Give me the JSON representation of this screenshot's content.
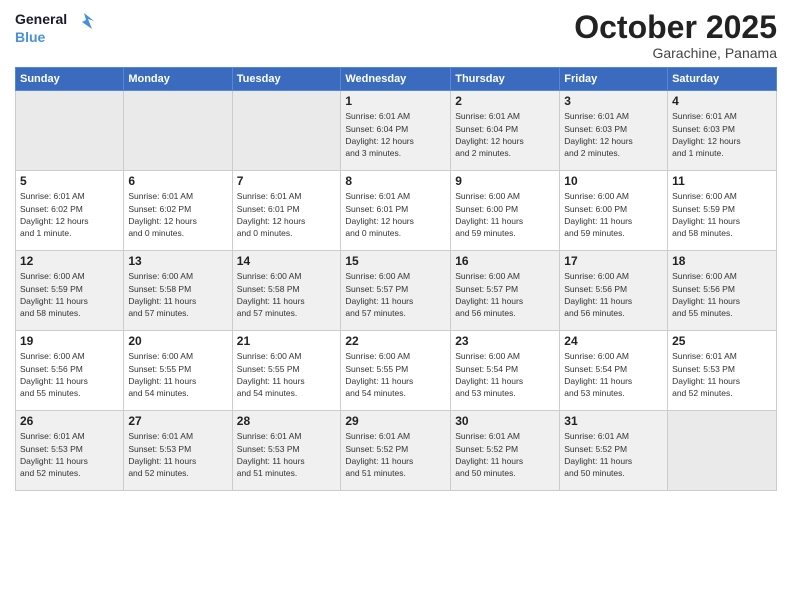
{
  "header": {
    "logo_line1": "General",
    "logo_line2": "Blue",
    "month": "October 2025",
    "location": "Garachine, Panama"
  },
  "weekdays": [
    "Sunday",
    "Monday",
    "Tuesday",
    "Wednesday",
    "Thursday",
    "Friday",
    "Saturday"
  ],
  "weeks": [
    [
      {
        "day": "",
        "info": ""
      },
      {
        "day": "",
        "info": ""
      },
      {
        "day": "",
        "info": ""
      },
      {
        "day": "1",
        "info": "Sunrise: 6:01 AM\nSunset: 6:04 PM\nDaylight: 12 hours\nand 3 minutes."
      },
      {
        "day": "2",
        "info": "Sunrise: 6:01 AM\nSunset: 6:04 PM\nDaylight: 12 hours\nand 2 minutes."
      },
      {
        "day": "3",
        "info": "Sunrise: 6:01 AM\nSunset: 6:03 PM\nDaylight: 12 hours\nand 2 minutes."
      },
      {
        "day": "4",
        "info": "Sunrise: 6:01 AM\nSunset: 6:03 PM\nDaylight: 12 hours\nand 1 minute."
      }
    ],
    [
      {
        "day": "5",
        "info": "Sunrise: 6:01 AM\nSunset: 6:02 PM\nDaylight: 12 hours\nand 1 minute."
      },
      {
        "day": "6",
        "info": "Sunrise: 6:01 AM\nSunset: 6:02 PM\nDaylight: 12 hours\nand 0 minutes."
      },
      {
        "day": "7",
        "info": "Sunrise: 6:01 AM\nSunset: 6:01 PM\nDaylight: 12 hours\nand 0 minutes."
      },
      {
        "day": "8",
        "info": "Sunrise: 6:01 AM\nSunset: 6:01 PM\nDaylight: 12 hours\nand 0 minutes."
      },
      {
        "day": "9",
        "info": "Sunrise: 6:00 AM\nSunset: 6:00 PM\nDaylight: 11 hours\nand 59 minutes."
      },
      {
        "day": "10",
        "info": "Sunrise: 6:00 AM\nSunset: 6:00 PM\nDaylight: 11 hours\nand 59 minutes."
      },
      {
        "day": "11",
        "info": "Sunrise: 6:00 AM\nSunset: 5:59 PM\nDaylight: 11 hours\nand 58 minutes."
      }
    ],
    [
      {
        "day": "12",
        "info": "Sunrise: 6:00 AM\nSunset: 5:59 PM\nDaylight: 11 hours\nand 58 minutes."
      },
      {
        "day": "13",
        "info": "Sunrise: 6:00 AM\nSunset: 5:58 PM\nDaylight: 11 hours\nand 57 minutes."
      },
      {
        "day": "14",
        "info": "Sunrise: 6:00 AM\nSunset: 5:58 PM\nDaylight: 11 hours\nand 57 minutes."
      },
      {
        "day": "15",
        "info": "Sunrise: 6:00 AM\nSunset: 5:57 PM\nDaylight: 11 hours\nand 57 minutes."
      },
      {
        "day": "16",
        "info": "Sunrise: 6:00 AM\nSunset: 5:57 PM\nDaylight: 11 hours\nand 56 minutes."
      },
      {
        "day": "17",
        "info": "Sunrise: 6:00 AM\nSunset: 5:56 PM\nDaylight: 11 hours\nand 56 minutes."
      },
      {
        "day": "18",
        "info": "Sunrise: 6:00 AM\nSunset: 5:56 PM\nDaylight: 11 hours\nand 55 minutes."
      }
    ],
    [
      {
        "day": "19",
        "info": "Sunrise: 6:00 AM\nSunset: 5:56 PM\nDaylight: 11 hours\nand 55 minutes."
      },
      {
        "day": "20",
        "info": "Sunrise: 6:00 AM\nSunset: 5:55 PM\nDaylight: 11 hours\nand 54 minutes."
      },
      {
        "day": "21",
        "info": "Sunrise: 6:00 AM\nSunset: 5:55 PM\nDaylight: 11 hours\nand 54 minutes."
      },
      {
        "day": "22",
        "info": "Sunrise: 6:00 AM\nSunset: 5:55 PM\nDaylight: 11 hours\nand 54 minutes."
      },
      {
        "day": "23",
        "info": "Sunrise: 6:00 AM\nSunset: 5:54 PM\nDaylight: 11 hours\nand 53 minutes."
      },
      {
        "day": "24",
        "info": "Sunrise: 6:00 AM\nSunset: 5:54 PM\nDaylight: 11 hours\nand 53 minutes."
      },
      {
        "day": "25",
        "info": "Sunrise: 6:01 AM\nSunset: 5:53 PM\nDaylight: 11 hours\nand 52 minutes."
      }
    ],
    [
      {
        "day": "26",
        "info": "Sunrise: 6:01 AM\nSunset: 5:53 PM\nDaylight: 11 hours\nand 52 minutes."
      },
      {
        "day": "27",
        "info": "Sunrise: 6:01 AM\nSunset: 5:53 PM\nDaylight: 11 hours\nand 52 minutes."
      },
      {
        "day": "28",
        "info": "Sunrise: 6:01 AM\nSunset: 5:53 PM\nDaylight: 11 hours\nand 51 minutes."
      },
      {
        "day": "29",
        "info": "Sunrise: 6:01 AM\nSunset: 5:52 PM\nDaylight: 11 hours\nand 51 minutes."
      },
      {
        "day": "30",
        "info": "Sunrise: 6:01 AM\nSunset: 5:52 PM\nDaylight: 11 hours\nand 50 minutes."
      },
      {
        "day": "31",
        "info": "Sunrise: 6:01 AM\nSunset: 5:52 PM\nDaylight: 11 hours\nand 50 minutes."
      },
      {
        "day": "",
        "info": ""
      }
    ]
  ]
}
